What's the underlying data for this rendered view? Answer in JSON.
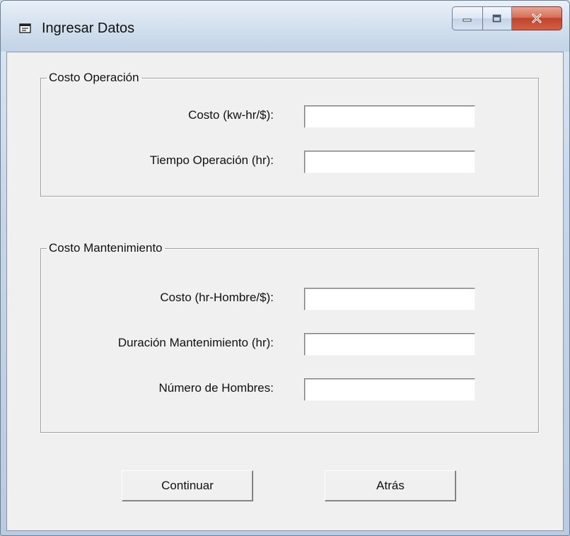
{
  "window": {
    "title": "Ingresar Datos"
  },
  "operacion": {
    "legend": "Costo Operación",
    "fields": [
      {
        "label": "Costo (kw-hr/$):",
        "value": ""
      },
      {
        "label": "Tiempo Operación (hr):",
        "value": ""
      }
    ]
  },
  "mantenimiento": {
    "legend": "Costo Mantenimiento",
    "fields": [
      {
        "label": "Costo (hr-Hombre/$):",
        "value": ""
      },
      {
        "label": "Duración Mantenimiento (hr):",
        "value": ""
      },
      {
        "label": "Número de Hombres:",
        "value": ""
      }
    ]
  },
  "buttons": {
    "continue_label": "Continuar",
    "back_label": "Atrás"
  },
  "icons": {
    "app": "form-window-icon",
    "minimize": "minimize-icon",
    "maximize": "maximize-icon",
    "close": "close-icon"
  },
  "colors": {
    "close_button": "#c8462e",
    "dialog_bg": "#f0f0f0"
  }
}
